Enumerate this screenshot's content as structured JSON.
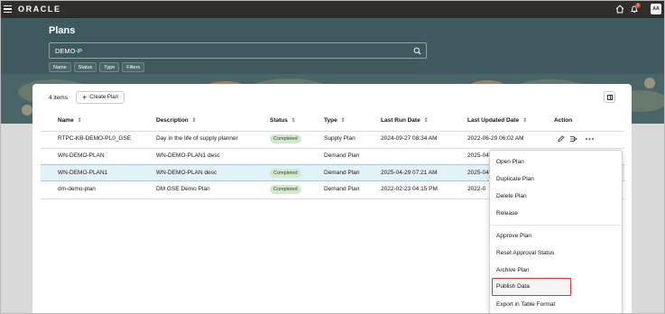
{
  "app": {
    "brand": "ORACLE",
    "notification_count": "2",
    "user_initials": "AA"
  },
  "page": {
    "title": "Plans"
  },
  "search": {
    "value": "DEMO-P"
  },
  "filter_chips": [
    "Name",
    "Status",
    "Type",
    "Filters"
  ],
  "toolbar": {
    "items_count": "4 items",
    "create_label": "Create Plan"
  },
  "table": {
    "columns": [
      "Name",
      "Description",
      "Status",
      "Type",
      "Last Run Date",
      "Last Updated Date",
      "Action"
    ],
    "rows": [
      {
        "name": "RTPC-KB-DEMO-PL0_GSE",
        "description": "Day in the life of supply planner",
        "status": "Completed",
        "type": "Supply Plan",
        "last_run": "2024-09-27 08:34 AM",
        "last_updated": "2022-06-29 06:02 AM"
      },
      {
        "name": "WN-DEMO-PLAN",
        "description": "WN-DEMO-PLAN1 desc",
        "status": "",
        "type": "Demand Plan",
        "last_run": "",
        "last_updated": "2025-04"
      },
      {
        "name": "WN-DEMO-PLAN1",
        "description": "WN-DEMO-PLAN desc",
        "status": "Completed",
        "type": "Demand Plan",
        "last_run": "2025-04-29 07:21 AM",
        "last_updated": "2025-04"
      },
      {
        "name": "dm-demo-plan",
        "description": "DM GSE Demo Plan",
        "status": "Completed",
        "type": "Demand Plan",
        "last_run": "2022-02-23 04:15 PM",
        "last_updated": "2022-0"
      }
    ]
  },
  "menu": {
    "group1": [
      "Open Plan",
      "Duplicate Plan",
      "Delete Plan",
      "Release"
    ],
    "group2": [
      "Approve Plan",
      "Reset Approval Status",
      "Archive Plan",
      "Publish Data",
      "Export in Table Format"
    ]
  }
}
